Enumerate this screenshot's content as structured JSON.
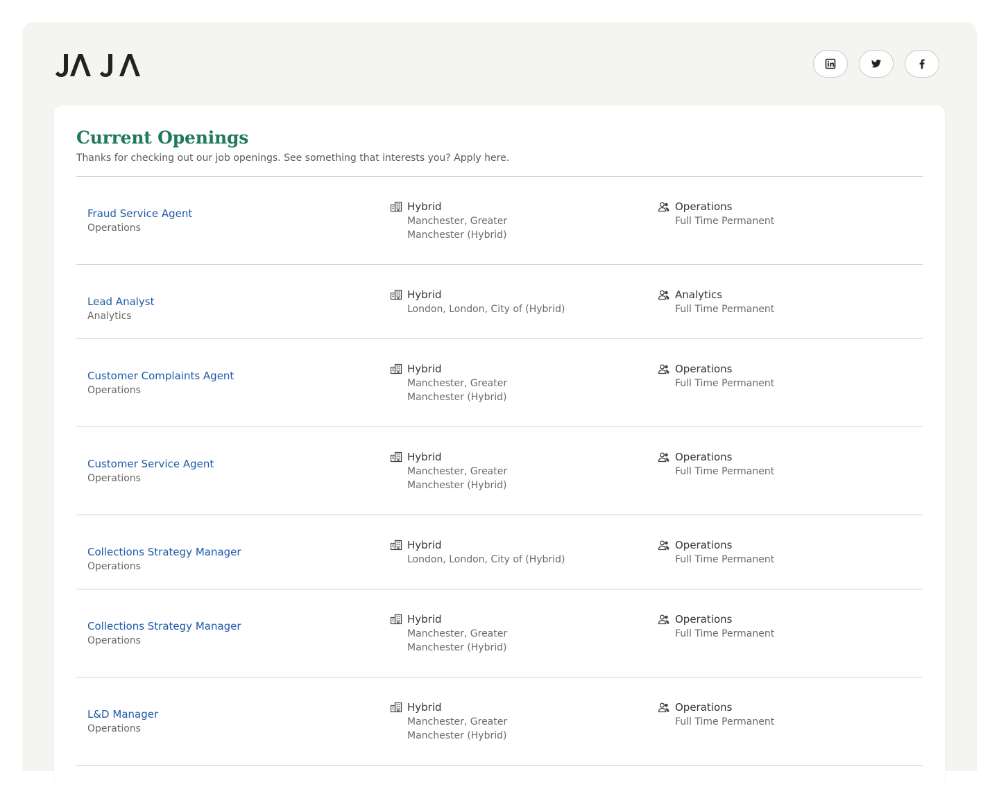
{
  "brand": {
    "logo_text": "JAJA"
  },
  "socials": [
    {
      "name": "linkedin",
      "icon": "linkedin-icon"
    },
    {
      "name": "twitter",
      "icon": "twitter-icon"
    },
    {
      "name": "facebook",
      "icon": "facebook-icon"
    }
  ],
  "header": {
    "title": "Current Openings",
    "subtitle": "Thanks for checking out our job openings. See something that interests you? Apply here."
  },
  "colors": {
    "title": "#1f7a5a",
    "link": "#1d59a8",
    "shell": "#f4f4f1"
  },
  "jobs": [
    {
      "title": "Fraud Service Agent",
      "dept": "Operations",
      "workplace": "Hybrid",
      "location": "Manchester, Greater Manchester (Hybrid)",
      "team": "Operations",
      "type": "Full Time Permanent"
    },
    {
      "title": "Lead Analyst",
      "dept": "Analytics",
      "workplace": "Hybrid",
      "location": "London, London, City of (Hybrid)",
      "team": "Analytics",
      "type": "Full Time Permanent"
    },
    {
      "title": "Customer Complaints Agent",
      "dept": "Operations",
      "workplace": "Hybrid",
      "location": "Manchester, Greater Manchester (Hybrid)",
      "team": "Operations",
      "type": "Full Time Permanent"
    },
    {
      "title": "Customer Service Agent",
      "dept": "Operations",
      "workplace": "Hybrid",
      "location": "Manchester, Greater Manchester (Hybrid)",
      "team": "Operations",
      "type": "Full Time Permanent"
    },
    {
      "title": "Collections Strategy Manager",
      "dept": "Operations",
      "workplace": "Hybrid",
      "location": "London, London, City of (Hybrid)",
      "team": "Operations",
      "type": "Full Time Permanent"
    },
    {
      "title": "Collections Strategy Manager",
      "dept": "Operations",
      "workplace": "Hybrid",
      "location": "Manchester, Greater Manchester (Hybrid)",
      "team": "Operations",
      "type": "Full Time Permanent"
    },
    {
      "title": "L&D Manager",
      "dept": "Operations",
      "workplace": "Hybrid",
      "location": "Manchester, Greater Manchester (Hybrid)",
      "team": "Operations",
      "type": "Full Time Permanent"
    }
  ]
}
